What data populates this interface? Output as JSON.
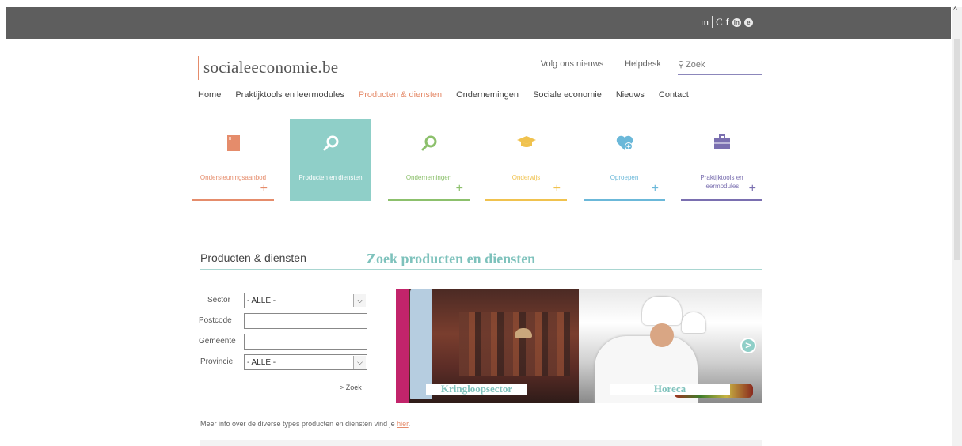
{
  "topbar": {
    "social": [
      "m",
      "C",
      "f",
      "in",
      "e"
    ]
  },
  "header": {
    "logo": "socialeeconomie.be",
    "follow_news": "Volg ons nieuws",
    "helpdesk": "Helpdesk",
    "search_placeholder": "Zoek"
  },
  "nav": [
    {
      "label": "Home"
    },
    {
      "label": "Praktijktools en leermodules"
    },
    {
      "label": "Producten & diensten",
      "active": true
    },
    {
      "label": "Ondernemingen"
    },
    {
      "label": "Sociale economie"
    },
    {
      "label": "Nieuws"
    },
    {
      "label": "Contact"
    }
  ],
  "tiles": [
    {
      "label": "Ondersteuningsaanbod",
      "icon": "book-icon",
      "color": "#e58c6b"
    },
    {
      "label": "Producten en diensten",
      "icon": "search-icon",
      "color": "#8fcfc8",
      "active": true
    },
    {
      "label": "Ondernemingen",
      "icon": "search-icon",
      "color": "#8cc06c"
    },
    {
      "label": "Onderwijs",
      "icon": "graduation-cap-icon",
      "color": "#f0c24e"
    },
    {
      "label": "Oproepen",
      "icon": "heart-plus-icon",
      "color": "#6bb8d9"
    },
    {
      "label": "Praktijktools en leermodules",
      "icon": "briefcase-icon",
      "color": "#7a6fb0"
    }
  ],
  "section": {
    "title": "Producten & diensten",
    "heading": "Zoek producten en diensten"
  },
  "form": {
    "sector_label": "Sector",
    "sector_value": "- ALLE -",
    "postcode_label": "Postcode",
    "gemeente_label": "Gemeente",
    "provincie_label": "Provincie",
    "provincie_value": "- ALLE -",
    "zoek_link": "> Zoek"
  },
  "slider": {
    "captions": [
      "Kringloopsector",
      "Horeca"
    ],
    "next": ">"
  },
  "footer": {
    "info_text": "Meer info over de diverse types producten en diensten vind je ",
    "info_link": "hier",
    "info_end": "."
  }
}
